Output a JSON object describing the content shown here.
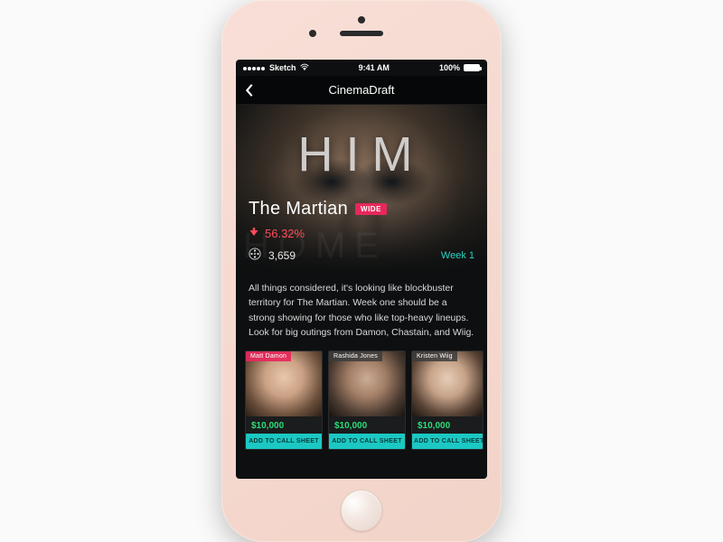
{
  "statusbar": {
    "carrier": "Sketch",
    "time": "9:41 AM",
    "battery": "100%"
  },
  "nav": {
    "title": "CinemaDraft"
  },
  "hero": {
    "bigword": "HIM",
    "ghostword": "HOME",
    "title": "The Martian",
    "badge": "WIDE",
    "drop_pct": "56.32%",
    "theater_count": "3,659",
    "week_label": "Week 1"
  },
  "description": "All things considered, it's looking like blockbuster territory for The Martian. Week one should be a strong showing for those who like top-heavy lineups. Look for big outings from Damon, Chastain, and Wiig.",
  "cast": [
    {
      "name": "Matt Damon",
      "price": "$10,000",
      "cta": "ADD TO CALL SHEET"
    },
    {
      "name": "Rashida Jones",
      "price": "$10,000",
      "cta": "ADD TO CALL SHEET"
    },
    {
      "name": "Kristen Wiig",
      "price": "$10,000",
      "cta": "ADD TO CALL SHEET"
    }
  ]
}
